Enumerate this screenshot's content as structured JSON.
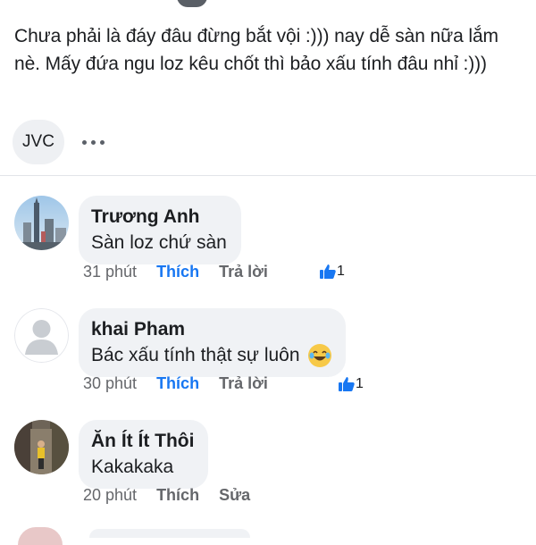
{
  "post": {
    "text": "Chưa phải là đáy đâu đừng bắt vội :))) nay dễ sàn nữa lắm nè. Mấy đứa ngu loz kêu chốt thì bảo xấu tính đâu nhỉ :)))"
  },
  "tag_row": {
    "tag_label": "JVC",
    "more_icon": "more-dots-icon"
  },
  "comments": [
    {
      "name": "Trương Anh",
      "text": "Sàn loz chứ sàn",
      "time": "31 phút",
      "like_label": "Thích",
      "action_label": "Trả lời",
      "reaction_icon": "like-thumb-icon",
      "reaction_count": "1",
      "liked": true
    },
    {
      "name": "khai Pham",
      "text": "Bác xấu tính thật sự luôn",
      "emoji": "laughing-tears-emoji",
      "time": "30 phút",
      "like_label": "Thích",
      "action_label": "Trả lời",
      "reaction_icon": "like-thumb-icon",
      "reaction_count": "1",
      "liked": true
    },
    {
      "name": "Ăn Ít Ít Thôi",
      "text": "Kakakaka",
      "time": "20 phút",
      "like_label": "Thích",
      "action_label": "Sửa",
      "liked": false
    }
  ],
  "colors": {
    "link_blue": "#1877f2",
    "meta_gray": "#65676b",
    "bubble_bg": "#f0f2f5"
  }
}
